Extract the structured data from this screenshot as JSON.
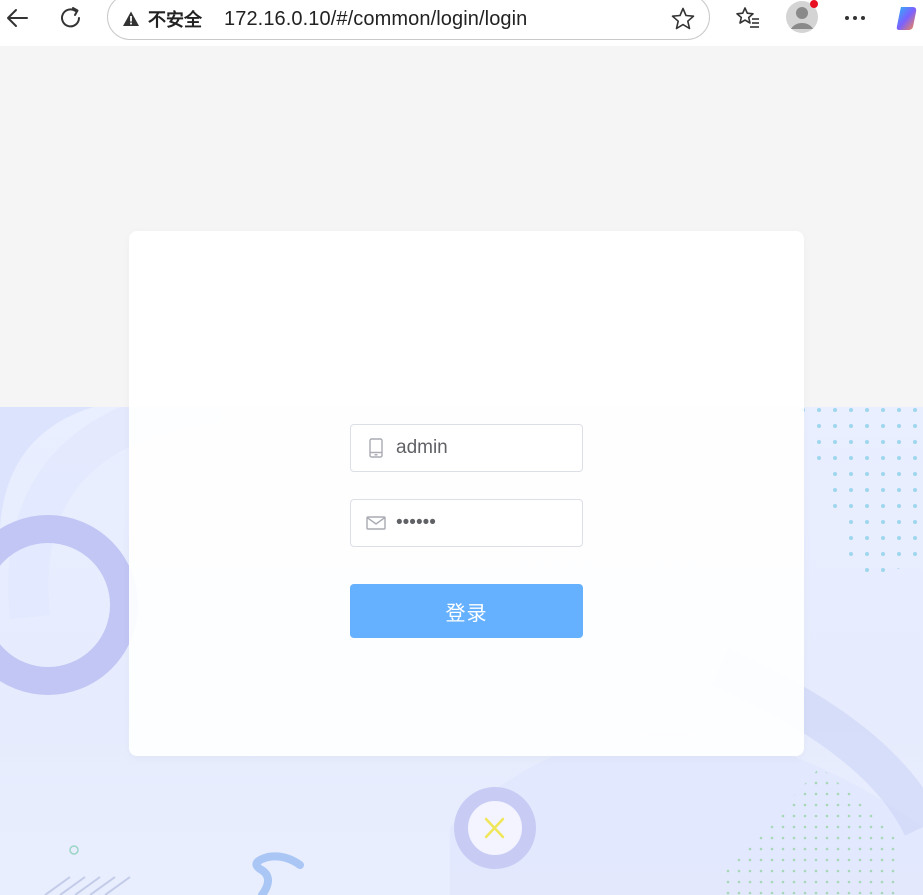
{
  "browser": {
    "security_label": "不安全",
    "url": "172.16.0.10/#/common/login/login"
  },
  "login": {
    "username_value": "admin",
    "password_value": "••••••",
    "submit_label": "登录"
  },
  "colors": {
    "button": "#66b1ff",
    "background_top": "#f5f5f5",
    "background_bottom": "#e9efff"
  }
}
